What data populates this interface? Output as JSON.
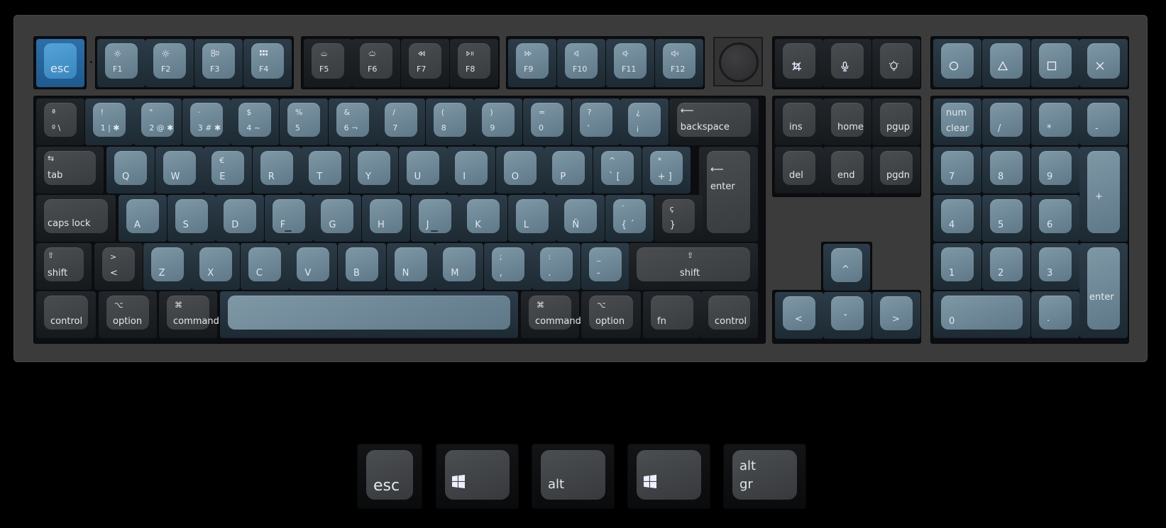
{
  "keyboard": {
    "colors": {
      "case": "#3b3b3c",
      "blue_keycap": "#6f8898",
      "dark_keycap": "#424548",
      "accent_keycap": "#4a97cf"
    },
    "fn_row": {
      "esc": "esc",
      "f_keys": [
        {
          "label": "F1",
          "icon": "brightness-down-icon"
        },
        {
          "label": "F2",
          "icon": "brightness-up-icon"
        },
        {
          "label": "F3",
          "icon": "mission-control-icon"
        },
        {
          "label": "F4",
          "icon": "launchpad-icon"
        },
        {
          "label": "F5",
          "icon": "backlight-down-icon"
        },
        {
          "label": "F6",
          "icon": "backlight-up-icon"
        },
        {
          "label": "F7",
          "icon": "rewind-icon"
        },
        {
          "label": "F8",
          "icon": "play-pause-icon"
        },
        {
          "label": "F9",
          "icon": "fast-forward-icon"
        },
        {
          "label": "F10",
          "icon": "mute-icon"
        },
        {
          "label": "F11",
          "icon": "volume-down-icon"
        },
        {
          "label": "F12",
          "icon": "volume-up-icon"
        }
      ],
      "extra": [
        {
          "name": "screenshot",
          "icon": "crop-icon"
        },
        {
          "name": "voice",
          "icon": "microphone-icon"
        },
        {
          "name": "light",
          "icon": "lightbulb-icon"
        }
      ],
      "macro": [
        {
          "name": "circle",
          "icon": "circle-icon"
        },
        {
          "name": "triangle",
          "icon": "triangle-icon"
        },
        {
          "name": "square",
          "icon": "square-icon"
        },
        {
          "name": "cross",
          "icon": "cross-icon"
        }
      ]
    },
    "number_row": [
      {
        "top": "ª",
        "bottom": "º  \\"
      },
      {
        "top": "!",
        "bottom": "1 | ✱"
      },
      {
        "top": "\"",
        "bottom": "2 @ ✱"
      },
      {
        "top": "·",
        "bottom": "3 # ✱"
      },
      {
        "top": "$",
        "bottom": "4  ~"
      },
      {
        "top": "%",
        "bottom": "5"
      },
      {
        "top": "&",
        "bottom": "6  ¬"
      },
      {
        "top": "/",
        "bottom": "7"
      },
      {
        "top": "(",
        "bottom": "8"
      },
      {
        "top": ")",
        "bottom": "9"
      },
      {
        "top": "=",
        "bottom": "0"
      },
      {
        "top": "?",
        "bottom": "'"
      },
      {
        "top": "¿",
        "bottom": "¡"
      }
    ],
    "backspace": "backspace",
    "tab": "tab",
    "qwerty": [
      {
        "top": "",
        "bottom": "Q"
      },
      {
        "top": "",
        "bottom": "W"
      },
      {
        "top": "€",
        "bottom": "E"
      },
      {
        "top": "",
        "bottom": "R"
      },
      {
        "top": "",
        "bottom": "T"
      },
      {
        "top": "",
        "bottom": "Y"
      },
      {
        "top": "",
        "bottom": "U"
      },
      {
        "top": "",
        "bottom": "I"
      },
      {
        "top": "",
        "bottom": "O"
      },
      {
        "top": "",
        "bottom": "P"
      },
      {
        "top": "^",
        "bottom": "`  ["
      },
      {
        "top": "*",
        "bottom": "+  ]"
      }
    ],
    "enter": "enter",
    "caps_lock": "caps lock",
    "home_row": [
      {
        "top": "",
        "bottom": "A"
      },
      {
        "top": "",
        "bottom": "S"
      },
      {
        "top": "",
        "bottom": "D"
      },
      {
        "top": "",
        "bottom": "F"
      },
      {
        "top": "",
        "bottom": "G"
      },
      {
        "top": "",
        "bottom": "H"
      },
      {
        "top": "",
        "bottom": "J"
      },
      {
        "top": "",
        "bottom": "K"
      },
      {
        "top": "",
        "bottom": "L"
      },
      {
        "top": "",
        "bottom": "Ñ"
      },
      {
        "top": "¨",
        "bottom": "{  ´"
      },
      {
        "top": "ç",
        "bottom": "}"
      }
    ],
    "shift": "shift",
    "bottom_row_letters": [
      {
        "top": ">",
        "bottom": "<"
      },
      {
        "top": "",
        "bottom": "Z"
      },
      {
        "top": "",
        "bottom": "X"
      },
      {
        "top": "",
        "bottom": "C"
      },
      {
        "top": "",
        "bottom": "V"
      },
      {
        "top": "",
        "bottom": "B"
      },
      {
        "top": "",
        "bottom": "N"
      },
      {
        "top": "",
        "bottom": "M"
      },
      {
        "top": ";",
        "bottom": ","
      },
      {
        "top": ":",
        "bottom": "."
      },
      {
        "top": "_",
        "bottom": "-"
      }
    ],
    "modifiers": {
      "control": "control",
      "option": "option",
      "option_glyph": "⌥",
      "command": "command",
      "command_glyph": "⌘",
      "fn": "fn",
      "shift_glyph": "⇧"
    },
    "nav": {
      "ins": "ins",
      "home": "home",
      "pgup": "pgup",
      "del": "del",
      "end": "end",
      "pgdn": "pgdn"
    },
    "arrows": {
      "up": "^",
      "left": "<",
      "down": "ˇ",
      "right": ">"
    },
    "numpad": {
      "num_clear_1": "num",
      "num_clear_2": "clear",
      "slash": "/",
      "asterisk": "*",
      "minus": "-",
      "plus": "+",
      "n7": "7",
      "n8": "8",
      "n9": "9",
      "n4": "4",
      "n5": "5",
      "n6": "6",
      "n1": "1",
      "n2": "2",
      "n3": "3",
      "n0": "0",
      "dot": ".",
      "enter": "enter"
    }
  },
  "spare_keys": [
    {
      "label": "esc",
      "icon": ""
    },
    {
      "label": "",
      "icon": "windows-icon"
    },
    {
      "label": "alt",
      "icon": ""
    },
    {
      "label": "",
      "icon": "windows-icon"
    },
    {
      "label": "alt\ngr",
      "line1": "alt",
      "line2": "gr",
      "icon": ""
    }
  ]
}
